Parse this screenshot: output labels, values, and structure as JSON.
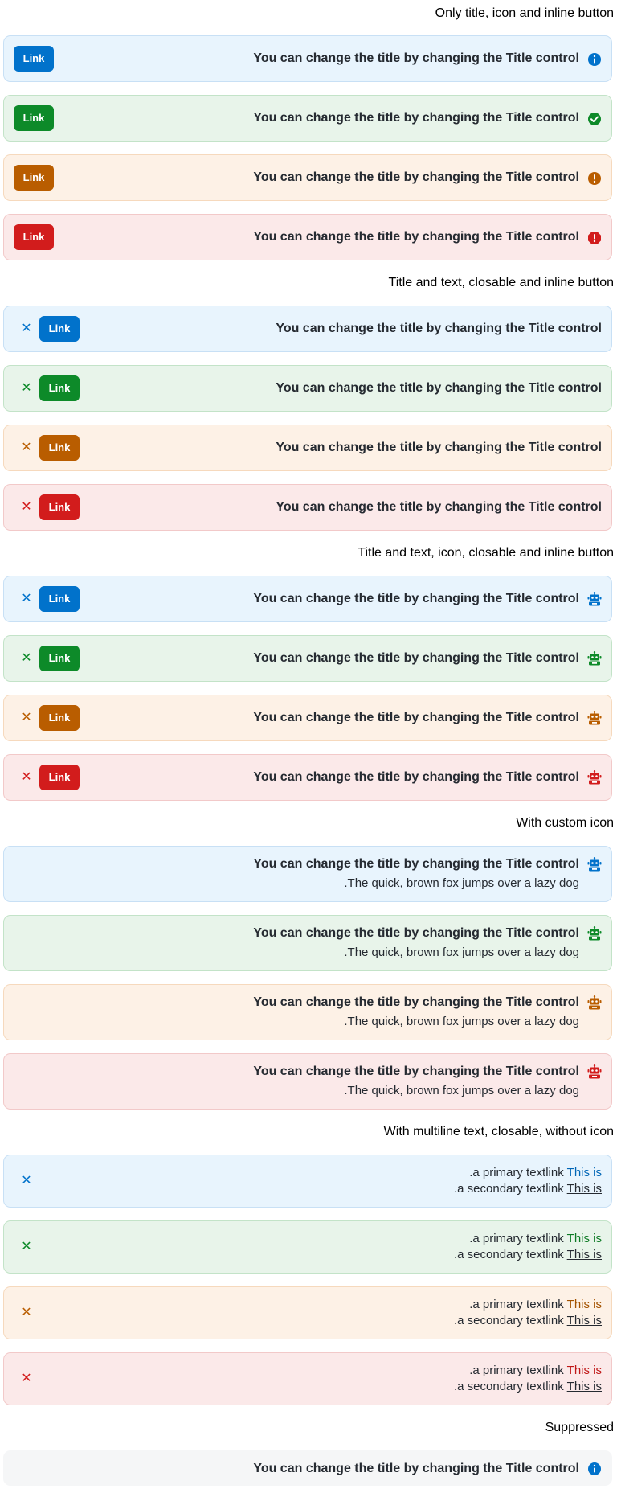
{
  "sections": {
    "s1": "Only title, icon and inline button",
    "s2": "Title and text, closable and inline button",
    "s3": "Title and text, icon, closable and inline button",
    "s4": "With custom icon",
    "s5": "With multiline text, closable, without icon",
    "s6": "Suppressed"
  },
  "alert_title": "You can change the title by changing the Title control",
  "alert_description": ".The quick, brown fox jumps over a lazy dog",
  "button_label": "Link",
  "close_glyph": "✕",
  "multiline": {
    "primary_link": "This is",
    "primary_text": ".a primary textlink",
    "secondary_link": "This is",
    "secondary_text": ".a secondary textlink"
  },
  "colors": {
    "info": "#0172cb",
    "success": "#0d8a29",
    "warning": "#b95d00",
    "critical": "#d21c1c"
  },
  "icons": {
    "info": "info-circle-icon",
    "success": "check-circle-icon",
    "warning": "alert-circle-icon",
    "critical": "alert-octagon-icon",
    "custom": "robot-icon"
  }
}
